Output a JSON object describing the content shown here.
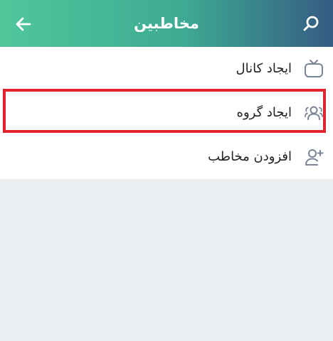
{
  "header": {
    "title": "مخاطبین",
    "back_icon": "arrow-left-icon",
    "search_icon": "search-icon"
  },
  "menu": {
    "items": [
      {
        "label": "ایجاد کانال",
        "icon": "tv-channel-icon"
      },
      {
        "label": "ایجاد گروه",
        "icon": "group-users-icon",
        "highlighted": true
      },
      {
        "label": "افزودن مخاطب",
        "icon": "add-user-icon"
      }
    ]
  },
  "colors": {
    "header_gradient_start": "#4fc79a",
    "header_gradient_end": "#355c82",
    "highlight_border": "#e0242f",
    "icon_color": "#7a8494",
    "background": "#ebeff2"
  }
}
